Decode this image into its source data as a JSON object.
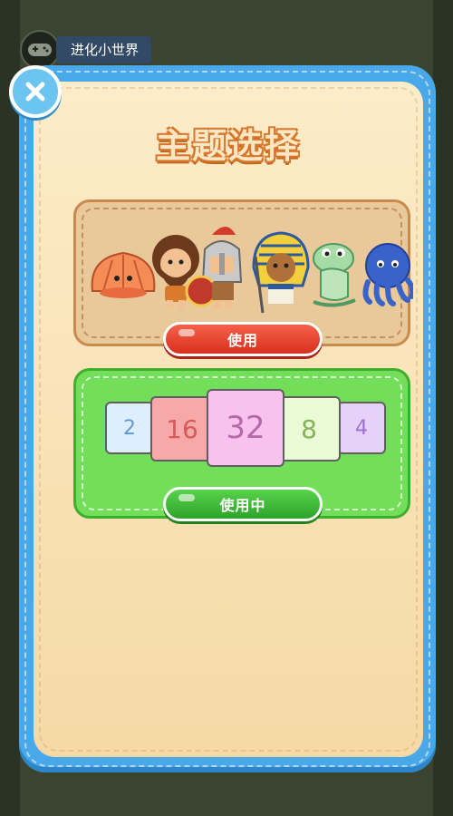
{
  "topbar": {
    "name": "进化小世界"
  },
  "panel": {
    "title": "主题选择"
  },
  "themes": [
    {
      "button_label": "使用",
      "button_color": "#e8412c"
    },
    {
      "button_label": "使用中",
      "button_color": "#3db836",
      "tiles": [
        {
          "value": "2",
          "bg": "#dfeeff",
          "fg": "#5b9ad8"
        },
        {
          "value": "16",
          "bg": "#f7a8a8",
          "fg": "#d65a5a"
        },
        {
          "value": "32",
          "bg": "#f7c2ee",
          "fg": "#b56aa7"
        },
        {
          "value": "8",
          "bg": "#eafbd5",
          "fg": "#86b35a"
        },
        {
          "value": "4",
          "bg": "#e6d1fb",
          "fg": "#9c71cf"
        }
      ]
    }
  ],
  "colors": {
    "frame": "#49a8e8",
    "panel": "#fbe3b8",
    "background": "#2b3324"
  }
}
